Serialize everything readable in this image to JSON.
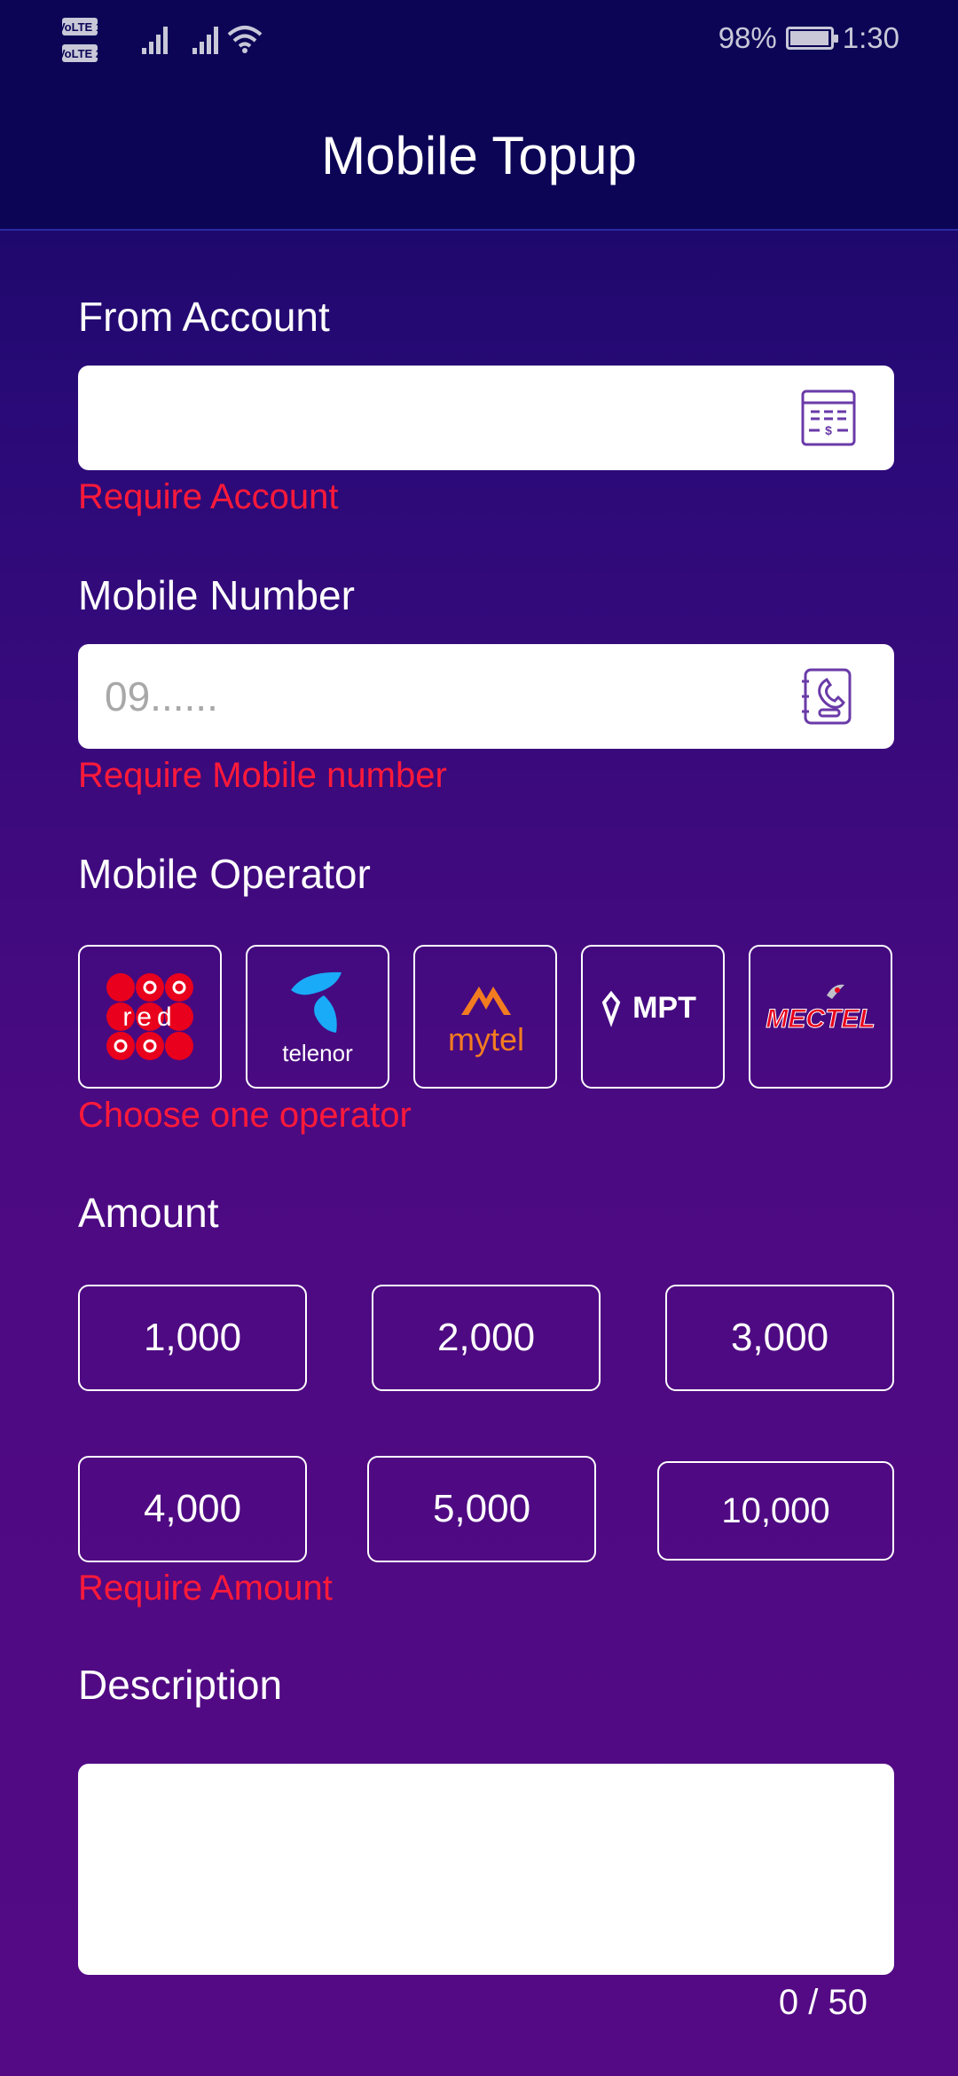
{
  "status_bar": {
    "volte1": "VoLTE 1",
    "volte2": "VoLTE 2",
    "battery": "98%",
    "battery_level": 0.98,
    "time": "1:30"
  },
  "header": {
    "title": "Mobile Topup"
  },
  "from_account": {
    "label": "From Account",
    "value": "",
    "icon": "bank-statement-icon",
    "error": "Require Account"
  },
  "mobile_number": {
    "label": "Mobile Number",
    "placeholder": "09......",
    "icon": "phone-contact-book-icon",
    "error": "Require Mobile number"
  },
  "operator": {
    "label": "Mobile Operator",
    "options": [
      {
        "name": "ooredoo",
        "logo_text": "red"
      },
      {
        "name": "telenor",
        "logo_text": "telenor"
      },
      {
        "name": "mytel",
        "logo_text": "mytel"
      },
      {
        "name": "mpt",
        "logo_text": "MPT"
      },
      {
        "name": "mectel",
        "logo_text": "MECTEL"
      }
    ],
    "error": "Choose one operator"
  },
  "amount": {
    "label": "Amount",
    "options": [
      "1,000",
      "2,000",
      "3,000",
      "4,000",
      "5,000",
      "10,000"
    ],
    "error": "Require Amount"
  },
  "description": {
    "label": "Description",
    "value": "",
    "counter": "0 / 50"
  },
  "colors": {
    "accent_error": "#ff1a3a",
    "bg_top": "#10065e",
    "bg_bottom": "#540a84",
    "icon_purple": "#6a3aa8"
  }
}
